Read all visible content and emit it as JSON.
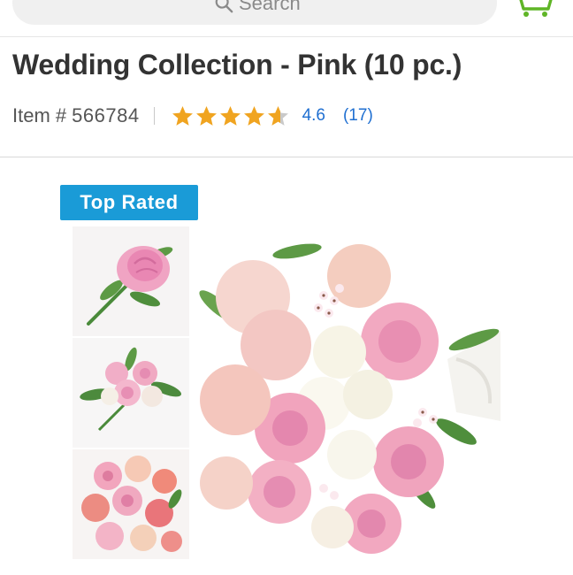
{
  "search": {
    "placeholder_text": "Search"
  },
  "product": {
    "title": "Wedding Collection - Pink (10 pc.)",
    "item_label": "Item #",
    "item_number": "566784",
    "rating_value": "4.6",
    "rating_max": 5,
    "review_count": "(17)",
    "badge": "Top Rated"
  },
  "gallery": {
    "thumbnails": [
      "boutonniere",
      "corsage",
      "bouquet"
    ],
    "main_image": "bridal-bouquet"
  },
  "colors": {
    "star": "#f0a420",
    "link": "#1f6fd1",
    "badge": "#1a9bd7",
    "cart": "#5fb526"
  },
  "icons": {
    "search": "search-icon",
    "cart": "cart-icon",
    "star": "star-icon"
  }
}
